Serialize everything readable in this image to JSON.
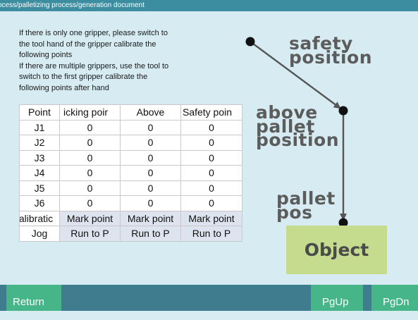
{
  "breadcrumb": "ocess/palletizing process/generation document",
  "instructions": [
    "If there is only one gripper, please switch to",
    "the tool hand of the gripper calibrate the",
    "following points",
    "If there are multiple grippers, use the tool to",
    "switch to the first gripper calibrate the",
    "following points after hand"
  ],
  "table": {
    "headers": [
      "Point",
      "icking poir",
      "Above",
      "Safety poin"
    ],
    "rows": [
      {
        "point": "J1",
        "values": [
          "0",
          "0",
          "0"
        ]
      },
      {
        "point": "J2",
        "values": [
          "0",
          "0",
          "0"
        ]
      },
      {
        "point": "J3",
        "values": [
          "0",
          "0",
          "0"
        ]
      },
      {
        "point": "J4",
        "values": [
          "0",
          "0",
          "0"
        ]
      },
      {
        "point": "J5",
        "values": [
          "0",
          "0",
          "0"
        ]
      },
      {
        "point": "J6",
        "values": [
          "0",
          "0",
          "0"
        ]
      }
    ],
    "calibration_label": "alibratic",
    "mark_buttons": [
      "Mark point",
      "Mark point",
      "Mark point"
    ],
    "jog_label": "Jog",
    "run_buttons": [
      "Run to P",
      "Run to P",
      "Run to P"
    ]
  },
  "diagram": {
    "safety_label_1": "safety",
    "safety_label_2": "position",
    "above_label_1": "above",
    "above_label_2": "pallet",
    "above_label_3": "position",
    "pallet_label_1": "pallet",
    "pallet_label_2": "pos",
    "object_label": "Object"
  },
  "footer": {
    "return_label": "Return",
    "pgup_label": "PgUp",
    "pgdn_label": "PgDn"
  },
  "colors": {
    "background": "#d6ecf2",
    "topbar": "#3d8da1",
    "bottombar": "#3e7c8e",
    "button": "#46b688",
    "object_box": "#c5dc8f"
  }
}
